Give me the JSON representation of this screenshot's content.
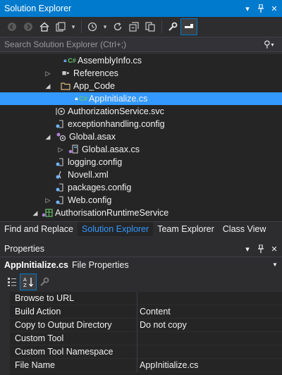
{
  "solution_explorer": {
    "title": "Solution Explorer",
    "title_buttons": [
      "dropdown-icon",
      "pin-icon",
      "close-icon"
    ],
    "search_placeholder": "Search Solution Explorer (Ctrl+;)",
    "tree": [
      {
        "label": "AssemblyInfo.cs",
        "icon": "csharp-file-icon",
        "expander": "",
        "locked": true,
        "selected": false
      },
      {
        "label": "References",
        "icon": "references-icon",
        "expander": "▷",
        "locked": false,
        "selected": false
      },
      {
        "label": "App_Code",
        "icon": "folder-icon",
        "expander": "◢",
        "locked": false,
        "selected": false
      },
      {
        "label": "AppInitialize.cs",
        "icon": "csharp-file-icon",
        "expander": "",
        "locked": true,
        "selected": true
      },
      {
        "label": "AuthorizationService.svc",
        "icon": "service-file-icon",
        "expander": "",
        "locked": true,
        "selected": false
      },
      {
        "label": "exceptionhandling.config",
        "icon": "config-file-icon",
        "expander": "",
        "locked": true,
        "selected": false
      },
      {
        "label": "Global.asax",
        "icon": "asax-file-icon",
        "expander": "◢",
        "locked": true,
        "selected": false
      },
      {
        "label": "Global.asax.cs",
        "icon": "csharp-file-icon",
        "expander": "▷",
        "locked": true,
        "selected": false
      },
      {
        "label": "logging.config",
        "icon": "config-file-icon",
        "expander": "",
        "locked": true,
        "selected": false
      },
      {
        "label": "Novell.xml",
        "icon": "xml-file-icon",
        "expander": "",
        "locked": true,
        "selected": false
      },
      {
        "label": "packages.config",
        "icon": "config-file-icon",
        "expander": "",
        "locked": true,
        "selected": false
      },
      {
        "label": "Web.config",
        "icon": "config-file-icon",
        "expander": "▷",
        "locked": true,
        "selected": false
      },
      {
        "label": "AuthorisationRuntimeService",
        "icon": "web-project-icon",
        "expander": "◢",
        "locked": true,
        "selected": false
      }
    ]
  },
  "bottom_tabs": [
    {
      "label": "Find and Replace",
      "active": false
    },
    {
      "label": "Solution Explorer",
      "active": true
    },
    {
      "label": "Team Explorer",
      "active": false
    },
    {
      "label": "Class View",
      "active": false
    }
  ],
  "properties": {
    "title": "Properties",
    "object_name": "AppInitialize.cs",
    "object_type": "File Properties",
    "rows": [
      {
        "name": "Browse to URL",
        "value": ""
      },
      {
        "name": "Build Action",
        "value": "Content"
      },
      {
        "name": "Copy to Output Directory",
        "value": "Do not copy"
      },
      {
        "name": "Custom Tool",
        "value": ""
      },
      {
        "name": "Custom Tool Namespace",
        "value": ""
      },
      {
        "name": "File Name",
        "value": "AppInitialize.cs"
      }
    ]
  },
  "colors": {
    "accent": "#007acc",
    "selection": "#3399ff",
    "background": "#252526",
    "chrome": "#2d2d30"
  }
}
